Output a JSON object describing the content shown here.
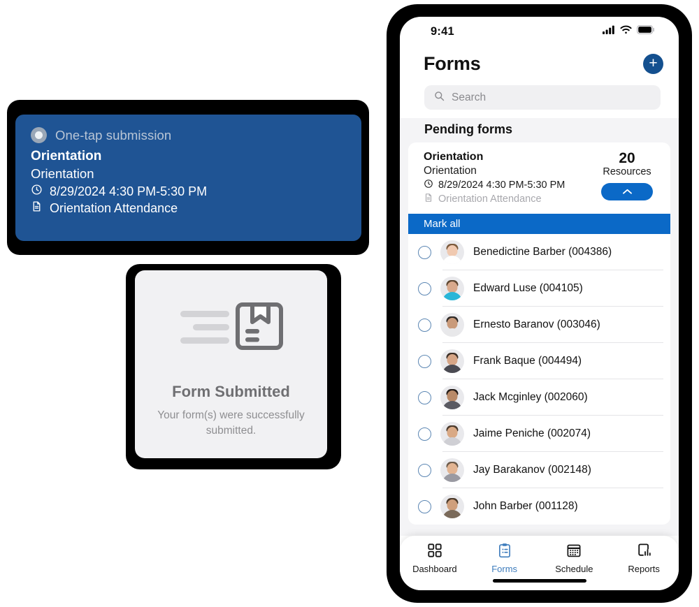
{
  "onetap_card": {
    "label": "One-tap submission",
    "title": "Orientation",
    "subtitle": "Orientation",
    "time": "8/29/2024 4:30 PM-5:30 PM",
    "form_name": "Orientation Attendance",
    "bg_color": "#1f5494"
  },
  "form_submitted_card": {
    "title": "Form Submitted",
    "message": "Your form(s) were successfully submitted.",
    "bg_color": "#f1f1f3"
  },
  "phone": {
    "status_bar": {
      "time": "9:41"
    },
    "header": {
      "title": "Forms",
      "add_label": "+"
    },
    "search": {
      "placeholder": "Search",
      "value": ""
    },
    "section_header": "Pending forms",
    "form_card": {
      "title": "Orientation",
      "subtitle": "Orientation",
      "time": "8/29/2024 4:30 PM-5:30 PM",
      "form_name": "Orientation Attendance",
      "count": "20",
      "count_label": "Resources",
      "collapse_label": "collapse"
    },
    "mark_all": "Mark all",
    "people": [
      {
        "name": "Benedictine Barber (004386)",
        "hair": "#7b5a3c",
        "skin": "#f0c9b0",
        "shirt": "#ffffff"
      },
      {
        "name": "Edward Luse (004105)",
        "hair": "#5d4630",
        "skin": "#d8a98c",
        "shirt": "#29b6d8"
      },
      {
        "name": "Ernesto Baranov (003046)",
        "hair": "#2f2a28",
        "skin": "#c99a7a",
        "shirt": "#e8e8ea"
      },
      {
        "name": "Frank Baque (004494)",
        "hair": "#3c2f26",
        "skin": "#d6a586",
        "shirt": "#4a4a52"
      },
      {
        "name": "Jack Mcginley (002060)",
        "hair": "#241c18",
        "skin": "#b98a68",
        "shirt": "#5a5a62"
      },
      {
        "name": "Jaime Peniche (002074)",
        "hair": "#4a3a2c",
        "skin": "#d9a985",
        "shirt": "#cfcfd4"
      },
      {
        "name": "Jay Barakanov (002148)",
        "hair": "#6d5b4a",
        "skin": "#e2b492",
        "shirt": "#9a9aa2"
      },
      {
        "name": "John Barber (001128)",
        "hair": "#4b3a2a",
        "skin": "#cf9f7c",
        "shirt": "#7a6a5a"
      }
    ],
    "tabs": [
      {
        "label": "Dashboard",
        "icon": "grid-icon",
        "active": false
      },
      {
        "label": "Forms",
        "icon": "clipboard-icon",
        "active": true
      },
      {
        "label": "Schedule",
        "icon": "calendar-icon",
        "active": false
      },
      {
        "label": "Reports",
        "icon": "report-chart-icon",
        "active": false
      }
    ],
    "accent_color": "#0b69c7"
  }
}
